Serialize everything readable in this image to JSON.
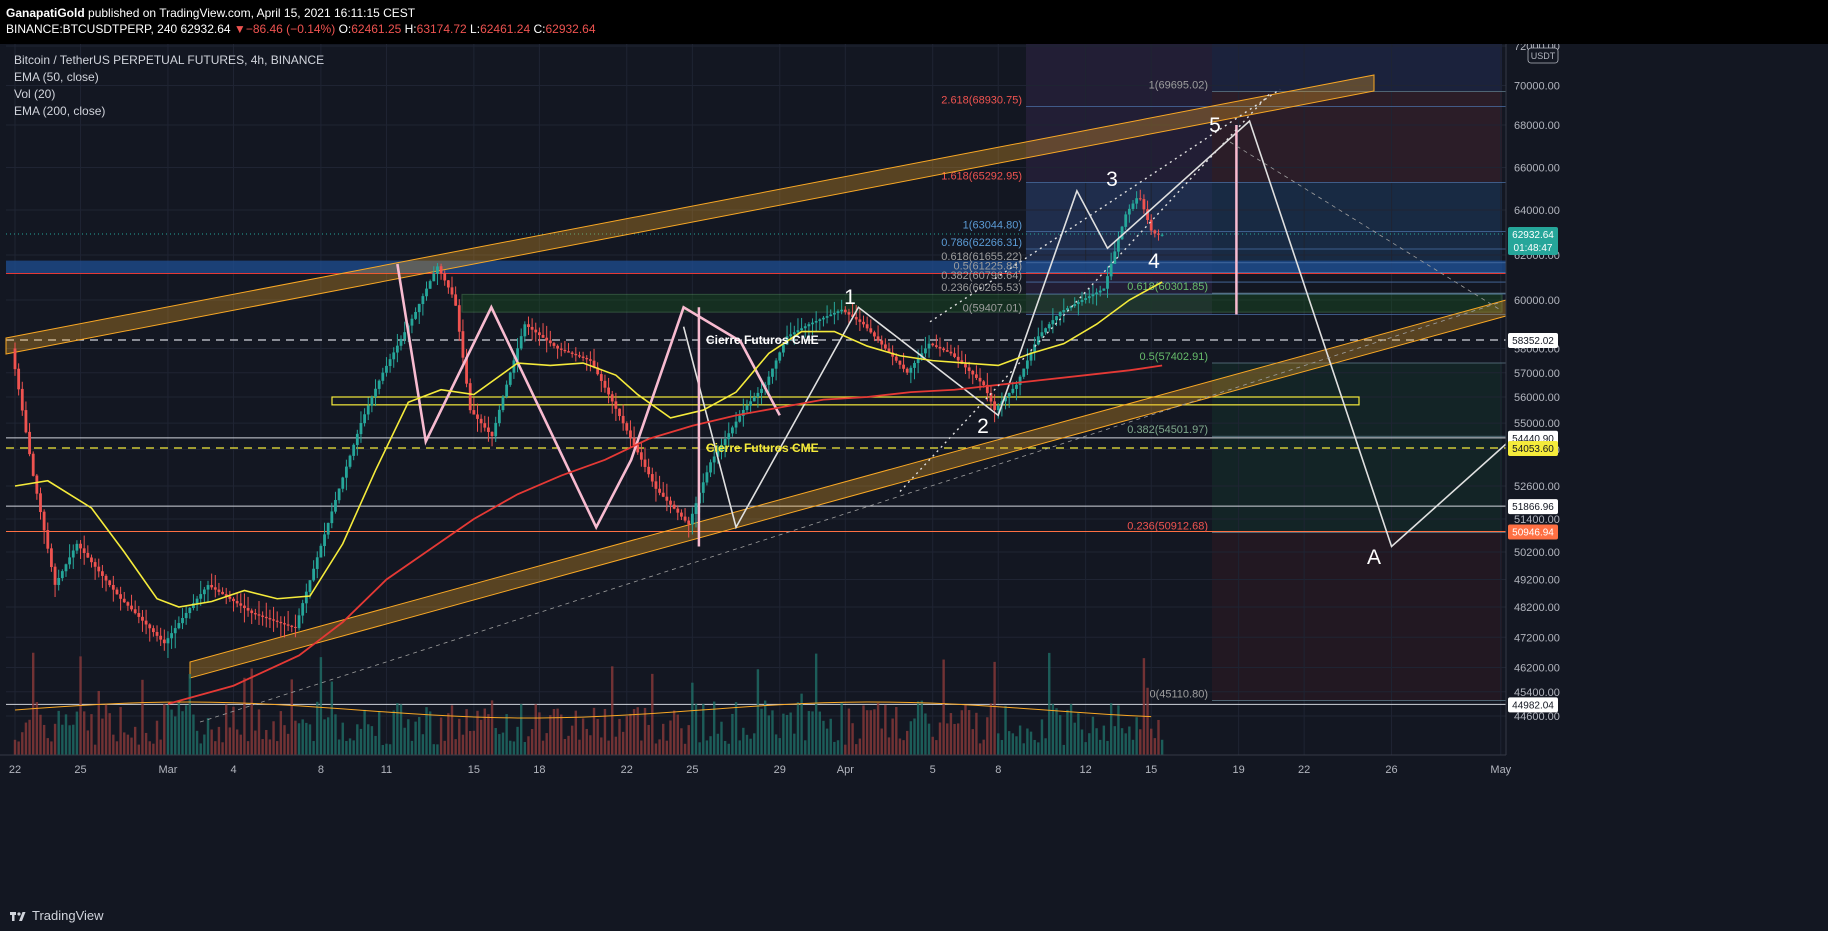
{
  "header": {
    "publisher": "GanapatiGold",
    "published_text": "published on TradingView.com, April 15, 2021 16:11:15 CEST",
    "symbol_line": "BINANCE:BTCUSDTPERP, 240",
    "last": "62932.64",
    "change_arrow": "▼",
    "change": "−86.46 (−0.14%)",
    "o_label": "O:",
    "o_val": "62461.25",
    "h_label": "H:",
    "h_val": "63174.72",
    "l_label": "L:",
    "l_val": "62461.24",
    "c_label": "C:",
    "c_val": "62932.64"
  },
  "legend": {
    "title": "Bitcoin / TetherUS PERPETUAL FUTURES, 4h, BINANCE",
    "ema50": "EMA (50, close)",
    "vol": "Vol (20)",
    "ema200": "EMA (200, close)"
  },
  "footer": {
    "brand": "TradingView",
    "brand_icon": "tradingview-logo-icon"
  },
  "colors": {
    "background": "#131722",
    "up": "#26a69a",
    "down": "#ef5350",
    "ema50": "#f5eb3b",
    "ema200": "#e53935",
    "channel": "#f9a825",
    "wave": "#f8bbd0",
    "projection": "#e0e0e0"
  },
  "chart_data": {
    "type": "line",
    "xlabel": "",
    "ylabel": "",
    "ylim": [
      43840,
      72000
    ],
    "currency": "USDT",
    "y_ticks": [
      "44600.00",
      "45400.00",
      "46200.00",
      "47200.00",
      "48200.00",
      "49200.00",
      "50200.00",
      "51400.00",
      "52600.00",
      "54000.00",
      "55000.00",
      "56000.00",
      "57000.00",
      "58000.00",
      "60000.00",
      "62000.00",
      "64000.00",
      "66000.00",
      "68000.00",
      "70000.00",
      "72000.00"
    ],
    "y_tick_values": [
      44600,
      45400,
      46200,
      47200,
      48200,
      49200,
      50200,
      51400,
      52600,
      54000,
      55000,
      56000,
      57000,
      58000,
      60000,
      62000,
      64000,
      66000,
      68000,
      70000,
      72000
    ],
    "x_ticks": [
      "22",
      "25",
      "Mar",
      "4",
      "8",
      "11",
      "15",
      "18",
      "22",
      "25",
      "29",
      "Apr",
      "5",
      "8",
      "12",
      "15",
      "19",
      "22",
      "26",
      "May"
    ],
    "x_tick_days": [
      0,
      3,
      7,
      10,
      14,
      17,
      21,
      24,
      28,
      31,
      35,
      38,
      42,
      45,
      49,
      52,
      56,
      59,
      63,
      68
    ],
    "price_tags": [
      {
        "value": "62932.64",
        "sub": "01:48:47",
        "color": "#26a69a"
      },
      {
        "value": "58352.02",
        "color": "#ffffff"
      },
      {
        "value": "54440.90",
        "color": "#ffffff"
      },
      {
        "value": "54053.60",
        "color": "#f5eb3b"
      },
      {
        "value": "51866.96",
        "color": "#ffffff"
      },
      {
        "value": "50946.94",
        "color": "#ff7043"
      },
      {
        "value": "44982.04",
        "color": "#ffffff"
      }
    ],
    "price_tag_values": [
      62932.64,
      58352.02,
      54440.9,
      54053.6,
      51866.96,
      50946.94,
      44982.04
    ],
    "fib_extension": [
      {
        "label": "2.618(68930.75)",
        "value": 68930.75
      },
      {
        "label": "1.618(65292.95)",
        "value": 65292.95
      },
      {
        "label": "1(63044.80)",
        "value": 63044.8
      },
      {
        "label": "0.786(62266.31)",
        "value": 62266.31
      },
      {
        "label": "0.618(61655.22)",
        "value": 61655.22
      },
      {
        "label": "0.5(61225.84)",
        "value": 61225.84
      },
      {
        "label": "0.382(60796.64)",
        "value": 60796.64
      },
      {
        "label": "0.236(60265.53)",
        "value": 60265.53
      },
      {
        "label": "0(59407.01)",
        "value": 59407.01
      }
    ],
    "fib_retracement": [
      {
        "label": "1(69695.02)",
        "value": 69695.02
      },
      {
        "label": "0.618(60301.85)",
        "value": 60301.85
      },
      {
        "label": "0.5(57402.91)",
        "value": 57402.91
      },
      {
        "label": "0.382(54501.97)",
        "value": 54501.97
      },
      {
        "label": "0.236(50912.68)",
        "value": 50912.68
      },
      {
        "label": "0(45110.80)",
        "value": 45110.8
      }
    ],
    "annotations": [
      {
        "text": "Cierre Futuros CME",
        "value": 58352.02
      },
      {
        "text": "Cierre Futuros CME",
        "value": 54053.6
      }
    ],
    "wave_labels": [
      "1",
      "2",
      "3",
      "4",
      "5",
      "A"
    ],
    "series": [
      {
        "name": "Elliott wave path",
        "points": [
          [
            30.6,
            58900
          ],
          [
            33.0,
            51100
          ],
          [
            38.6,
            59700
          ],
          [
            45.0,
            55300
          ],
          [
            48.6,
            64900
          ],
          [
            50.0,
            62300
          ],
          [
            56.5,
            68200
          ],
          [
            63.0,
            50400
          ],
          [
            68.5,
            54400
          ]
        ]
      },
      {
        "name": "Price swing path",
        "points": [
          [
            17.5,
            61600
          ],
          [
            18.8,
            54300
          ],
          [
            21.8,
            59700
          ],
          [
            26.6,
            51100
          ],
          [
            28.2,
            53600
          ],
          [
            30.6,
            59700
          ],
          [
            33.2,
            58300
          ],
          [
            35.0,
            55300
          ]
        ]
      },
      {
        "name": "EMA (50, close)",
        "points": [
          [
            0,
            52600
          ],
          [
            1.5,
            52800
          ],
          [
            3.5,
            51800
          ],
          [
            5,
            50200
          ],
          [
            6.5,
            48500
          ],
          [
            7.5,
            48200
          ],
          [
            9,
            48400
          ],
          [
            10.5,
            48800
          ],
          [
            12,
            48500
          ],
          [
            13.5,
            48600
          ],
          [
            15,
            50500
          ],
          [
            16.5,
            53200
          ],
          [
            18,
            55800
          ],
          [
            19.5,
            56300
          ],
          [
            21,
            56100
          ],
          [
            23,
            57400
          ],
          [
            24.5,
            57300
          ],
          [
            26,
            57400
          ],
          [
            27.5,
            56900
          ],
          [
            28.5,
            56100
          ],
          [
            30,
            55200
          ],
          [
            31.5,
            55500
          ],
          [
            33,
            56200
          ],
          [
            34.5,
            57800
          ],
          [
            36,
            58700
          ],
          [
            37.5,
            58700
          ],
          [
            39,
            58100
          ],
          [
            40.5,
            57700
          ],
          [
            42,
            57500
          ],
          [
            43.5,
            57400
          ],
          [
            45,
            57300
          ],
          [
            46.5,
            57800
          ],
          [
            48,
            58200
          ],
          [
            49.5,
            59000
          ],
          [
            51,
            60000
          ],
          [
            52.5,
            60800
          ]
        ]
      },
      {
        "name": "EMA (200, close)",
        "points": [
          [
            7,
            45000
          ],
          [
            10,
            45600
          ],
          [
            13,
            46600
          ],
          [
            15,
            47700
          ],
          [
            17,
            49200
          ],
          [
            19,
            50300
          ],
          [
            21,
            51400
          ],
          [
            23,
            52300
          ],
          [
            25,
            53000
          ],
          [
            27,
            53600
          ],
          [
            29,
            54400
          ],
          [
            31,
            54900
          ],
          [
            33,
            55300
          ],
          [
            35,
            55600
          ],
          [
            37,
            55900
          ],
          [
            39,
            56000
          ],
          [
            41,
            56200
          ],
          [
            43,
            56300
          ],
          [
            45,
            56500
          ],
          [
            47,
            56700
          ],
          [
            49,
            56900
          ],
          [
            51,
            57100
          ],
          [
            52.5,
            57300
          ]
        ]
      }
    ]
  }
}
